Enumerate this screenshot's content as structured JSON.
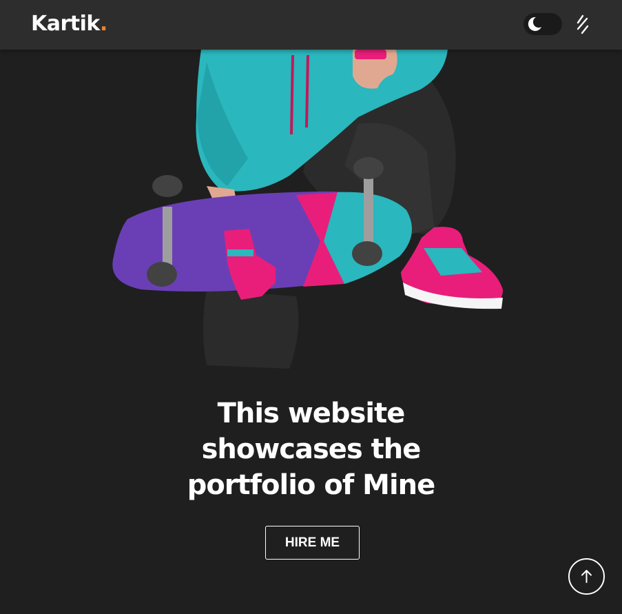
{
  "header": {
    "logo_text": "Kartik",
    "logo_dot": ".",
    "theme_toggle_icon": "moon-icon",
    "menu_icon": "menu-icon"
  },
  "hero": {
    "image_description": "skateboarder-illustration",
    "headline_lines": [
      "This website",
      "showcases the",
      "portfolio of Mine"
    ],
    "cta_label": "HIRE ME"
  },
  "scroll_top": {
    "icon": "arrow-up-icon"
  },
  "colors": {
    "background": "#1f1f1f",
    "navbar": "#2d2d2d",
    "accent_dot": "#e8852b",
    "text": "#ffffff"
  }
}
